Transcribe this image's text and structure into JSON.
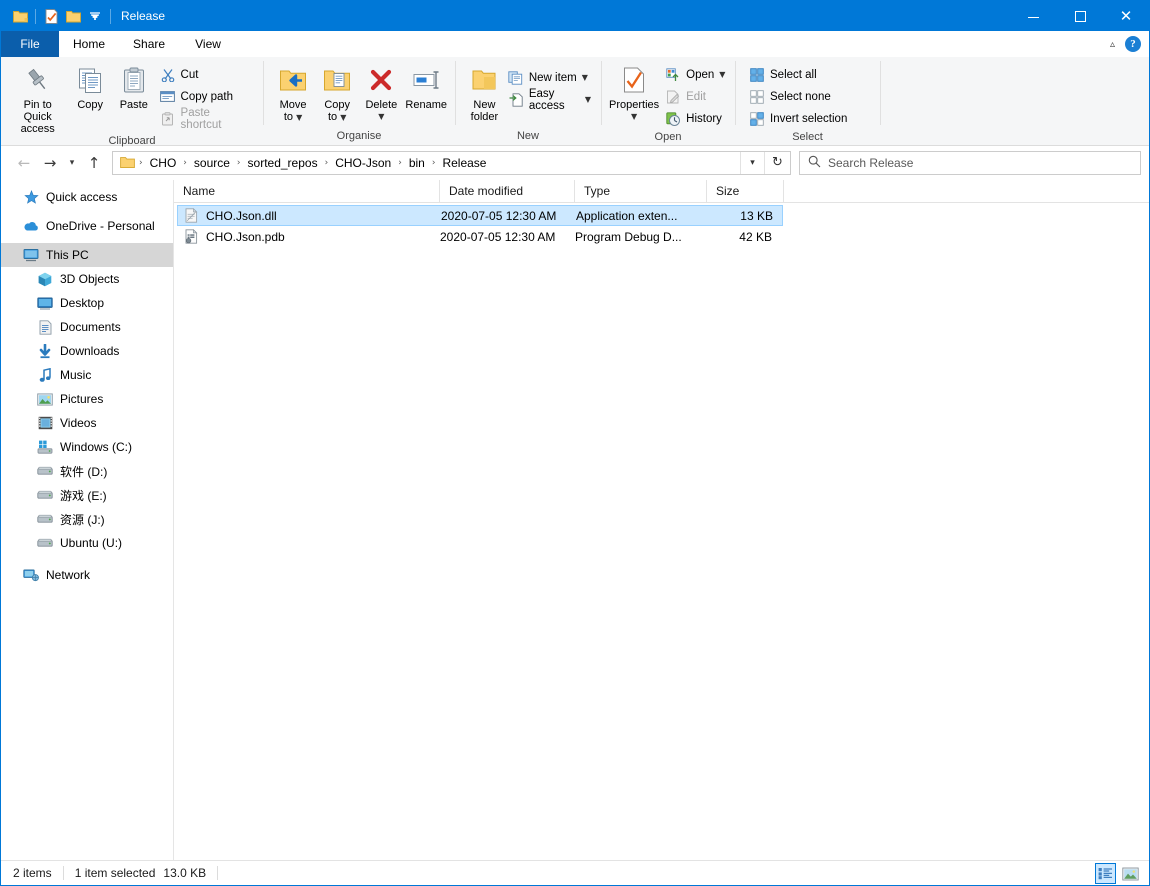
{
  "window": {
    "title": "Release",
    "quick_access_icons": [
      "folder-icon",
      "properties-check-icon",
      "new-folder-icon",
      "qat-dropdown-icon"
    ],
    "controls": {
      "minimize": "minimize-icon",
      "maximize": "maximize-icon",
      "close": "close-icon"
    },
    "accent_color": "#0078d7"
  },
  "ribbon": {
    "tabs": [
      {
        "label": "File",
        "active": false,
        "is_file": true
      },
      {
        "label": "Home",
        "active": true,
        "is_file": false
      },
      {
        "label": "Share",
        "active": false,
        "is_file": false
      },
      {
        "label": "View",
        "active": false,
        "is_file": false
      }
    ],
    "collapse_label": "^",
    "help_label": "?",
    "groups": [
      {
        "name": "Clipboard",
        "label": "Clipboard",
        "big_buttons": [
          {
            "label": "Pin to Quick\naccess",
            "line1": "Pin to Quick",
            "line2": "access",
            "icon": "pin-icon"
          },
          {
            "label": "Copy",
            "line1": "Copy",
            "line2": "",
            "icon": "copy-icon"
          },
          {
            "label": "Paste",
            "line1": "Paste",
            "line2": "",
            "icon": "paste-icon"
          }
        ],
        "small_buttons": [
          {
            "label": "Cut",
            "icon": "scissors-icon",
            "disabled": false
          },
          {
            "label": "Copy path",
            "icon": "copy-path-icon",
            "disabled": false
          },
          {
            "label": "Paste shortcut",
            "icon": "paste-shortcut-icon",
            "disabled": true
          }
        ]
      },
      {
        "name": "Organise",
        "label": "Organise",
        "big_buttons": [
          {
            "line1": "Move",
            "line2": "to",
            "icon": "move-to-icon",
            "has_caret": true
          },
          {
            "line1": "Copy",
            "line2": "to",
            "icon": "copy-to-icon",
            "has_caret": true
          },
          {
            "line1": "Delete",
            "line2": "",
            "icon": "delete-icon",
            "has_caret": true
          },
          {
            "line1": "Rename",
            "line2": "",
            "icon": "rename-icon",
            "has_caret": false
          }
        ],
        "small_buttons": []
      },
      {
        "name": "New",
        "label": "New",
        "big_buttons": [
          {
            "line1": "New",
            "line2": "folder",
            "icon": "new-folder-icon",
            "has_caret": false
          }
        ],
        "small_buttons": [
          {
            "label": "New item",
            "icon": "new-item-icon",
            "has_caret": true,
            "disabled": false
          },
          {
            "label": "Easy access",
            "icon": "easy-access-icon",
            "has_caret": true,
            "disabled": false
          }
        ]
      },
      {
        "name": "Open",
        "label": "Open",
        "big_buttons": [
          {
            "line1": "Properties",
            "line2": "",
            "icon": "properties-icon",
            "has_caret": true
          }
        ],
        "small_buttons": [
          {
            "label": "Open",
            "icon": "open-icon",
            "has_caret": true,
            "disabled": false
          },
          {
            "label": "Edit",
            "icon": "edit-icon",
            "has_caret": false,
            "disabled": true
          },
          {
            "label": "History",
            "icon": "history-icon",
            "has_caret": false,
            "disabled": false
          }
        ]
      },
      {
        "name": "Select",
        "label": "Select",
        "big_buttons": [],
        "small_buttons": [
          {
            "label": "Select all",
            "icon": "select-all-icon",
            "disabled": false
          },
          {
            "label": "Select none",
            "icon": "select-none-icon",
            "disabled": false
          },
          {
            "label": "Invert selection",
            "icon": "invert-selection-icon",
            "disabled": false
          }
        ]
      }
    ]
  },
  "addressbar": {
    "back_icon": "arrow-left-icon",
    "forward_icon": "arrow-right-icon",
    "recent_icon": "chevron-down-icon",
    "up_icon": "arrow-up-icon",
    "folder_icon": "folder-icon",
    "breadcrumbs": [
      "CHO",
      "source",
      "sorted_repos",
      "CHO-Json",
      "bin",
      "Release"
    ],
    "separator": "›",
    "dropdown_icon": "chevron-down-icon",
    "refresh_icon": "refresh-icon",
    "search": {
      "placeholder": "Search Release",
      "value": "",
      "icon": "search-icon"
    }
  },
  "sidebar": {
    "items": [
      {
        "label": "Quick access",
        "icon": "star-pin-icon",
        "indent": false,
        "state": "none"
      },
      {
        "label": "OneDrive - Personal",
        "icon": "onedrive-cloud-icon",
        "indent": false,
        "state": "none"
      },
      {
        "label": "This PC",
        "icon": "this-pc-icon",
        "indent": false,
        "state": "grayhl"
      },
      {
        "label": "3D Objects",
        "icon": "3d-objects-icon",
        "indent": true,
        "state": "none"
      },
      {
        "label": "Desktop",
        "icon": "desktop-icon",
        "indent": true,
        "state": "none"
      },
      {
        "label": "Documents",
        "icon": "documents-icon",
        "indent": true,
        "state": "none"
      },
      {
        "label": "Downloads",
        "icon": "downloads-icon",
        "indent": true,
        "state": "none"
      },
      {
        "label": "Music",
        "icon": "music-icon",
        "indent": true,
        "state": "none"
      },
      {
        "label": "Pictures",
        "icon": "pictures-icon",
        "indent": true,
        "state": "none"
      },
      {
        "label": "Videos",
        "icon": "videos-icon",
        "indent": true,
        "state": "none"
      },
      {
        "label": "Windows (C:)",
        "icon": "windows-drive-icon",
        "indent": true,
        "state": "none"
      },
      {
        "label": "软件 (D:)",
        "icon": "drive-icon",
        "indent": true,
        "state": "none"
      },
      {
        "label": "游戏 (E:)",
        "icon": "drive-icon",
        "indent": true,
        "state": "none"
      },
      {
        "label": "资源 (J:)",
        "icon": "drive-icon",
        "indent": true,
        "state": "none"
      },
      {
        "label": "Ubuntu (U:)",
        "icon": "drive-icon",
        "indent": true,
        "state": "none"
      },
      {
        "label": "Network",
        "icon": "network-icon",
        "indent": false,
        "state": "none"
      }
    ]
  },
  "filelist": {
    "columns": [
      {
        "label": "Name",
        "sorted": "asc"
      },
      {
        "label": "Date modified",
        "sorted": "none"
      },
      {
        "label": "Type",
        "sorted": "none"
      },
      {
        "label": "Size",
        "sorted": "none"
      }
    ],
    "rows": [
      {
        "name": "CHO.Json.dll",
        "date": "2020-07-05 12:30 AM",
        "type": "Application exten...",
        "size": "13 KB",
        "icon": "dll-file-icon",
        "selected": true
      },
      {
        "name": "CHO.Json.pdb",
        "date": "2020-07-05 12:30 AM",
        "type": "Program Debug D...",
        "size": "42 KB",
        "icon": "pdb-file-icon",
        "selected": false
      }
    ]
  },
  "statusbar": {
    "item_count": "2 items",
    "selection": "1 item selected",
    "selection_size": "13.0 KB",
    "view_buttons": [
      {
        "name": "details-view-button",
        "active": true
      },
      {
        "name": "large-icons-view-button",
        "active": false
      }
    ]
  }
}
